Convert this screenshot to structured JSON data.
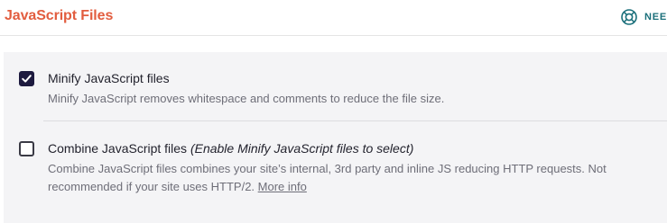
{
  "header": {
    "title": "JavaScript Files",
    "help_label": "NEE",
    "help_icon": "lifebuoy-icon",
    "title_color": "#e25d3f",
    "help_color": "#1a6f7a"
  },
  "options": [
    {
      "checked": true,
      "title": "Minify JavaScript files",
      "description": "Minify JavaScript removes whitespace and comments to reduce the file size."
    },
    {
      "checked": false,
      "title": "Combine JavaScript files",
      "title_note": "(Enable Minify JavaScript files to select)",
      "description_line1": "Combine JavaScript files combines your site’s internal, 3rd party and inline JS reducing HTTP requests. Not",
      "description_line2": "recommended if your site uses HTTP/2.",
      "more_info_link": "More info"
    }
  ]
}
